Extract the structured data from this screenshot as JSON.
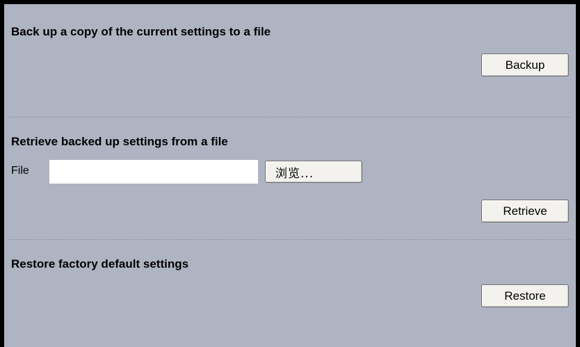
{
  "backup_section": {
    "title": "Back up a copy of the current settings to a file",
    "button_label": "Backup"
  },
  "retrieve_section": {
    "title": "Retrieve backed up settings from a file",
    "file_label": "File",
    "file_value": "",
    "browse_label": "浏览...",
    "button_label": "Retrieve"
  },
  "restore_section": {
    "title": "Restore factory default settings",
    "button_label": "Restore"
  }
}
